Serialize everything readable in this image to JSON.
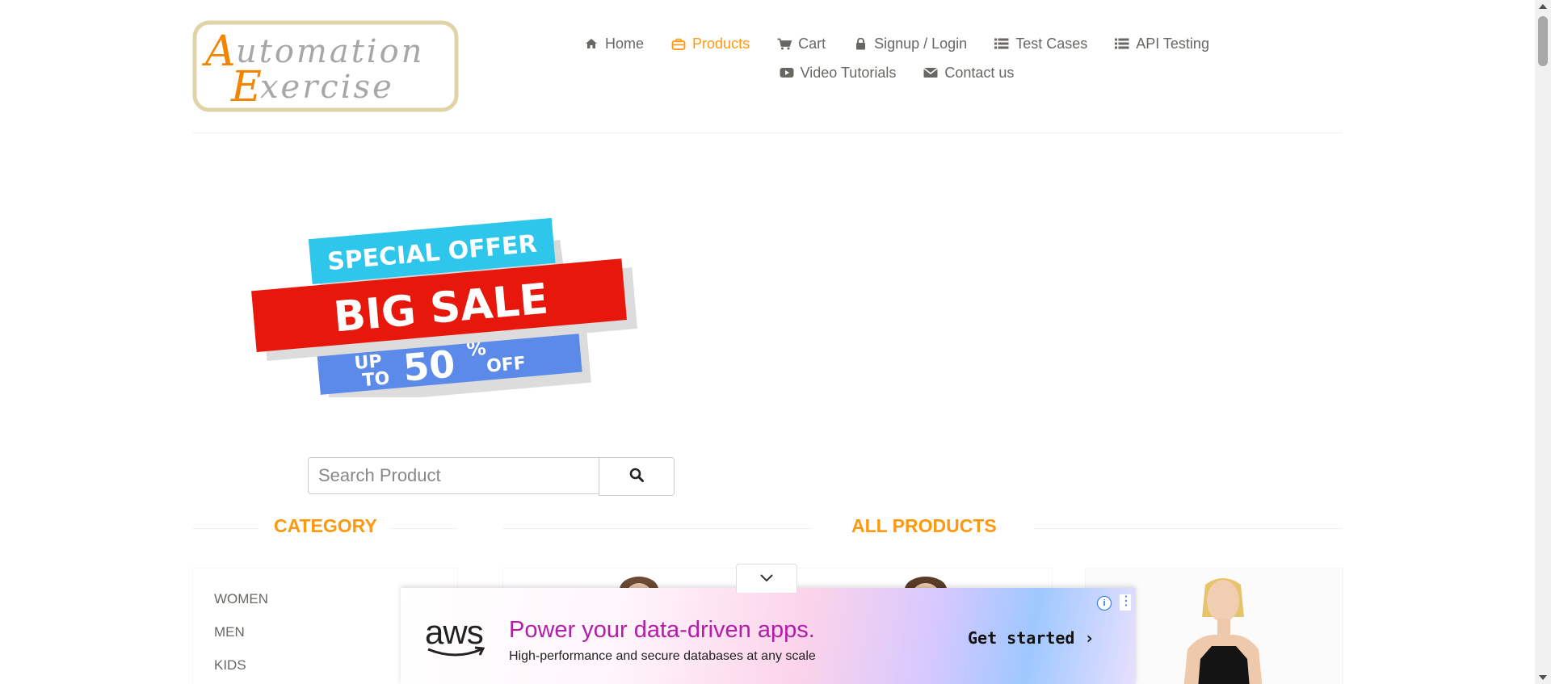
{
  "logo": {
    "line1": "Automation",
    "line2": "Exercise"
  },
  "nav": {
    "row1": [
      {
        "label": "Home",
        "icon": "home-icon"
      },
      {
        "label": "Products",
        "icon": "briefcase-icon",
        "active": true
      },
      {
        "label": "Cart",
        "icon": "cart-icon"
      },
      {
        "label": "Signup / Login",
        "icon": "lock-icon"
      },
      {
        "label": "Test Cases",
        "icon": "list-icon"
      },
      {
        "label": "API Testing",
        "icon": "list-icon"
      }
    ],
    "row2": [
      {
        "label": "Video Tutorials",
        "icon": "youtube-icon"
      },
      {
        "label": "Contact us",
        "icon": "envelope-icon"
      }
    ]
  },
  "banner": {
    "special": "SPECIAL OFFER",
    "big": "BIG SALE",
    "up": "UP",
    "to": "TO",
    "percent": "50",
    "pct_sign": "%",
    "off": "OFF"
  },
  "search": {
    "placeholder": "Search Product",
    "value": ""
  },
  "sections": {
    "category": "CATEGORY",
    "products": "ALL PRODUCTS"
  },
  "categories": [
    "WOMEN",
    "MEN",
    "KIDS"
  ],
  "ad": {
    "brand": "aws",
    "title": "Power your data-driven apps.",
    "subtitle": "High-performance and secure databases at any scale",
    "cta": "Get started ›",
    "info": "i",
    "menu": "⋮"
  },
  "colors": {
    "accent": "#FE980F",
    "text": "#696763",
    "banner_cyan": "#2ec6ea",
    "banner_red": "#e8170c",
    "banner_blue": "#5b8ae8"
  }
}
